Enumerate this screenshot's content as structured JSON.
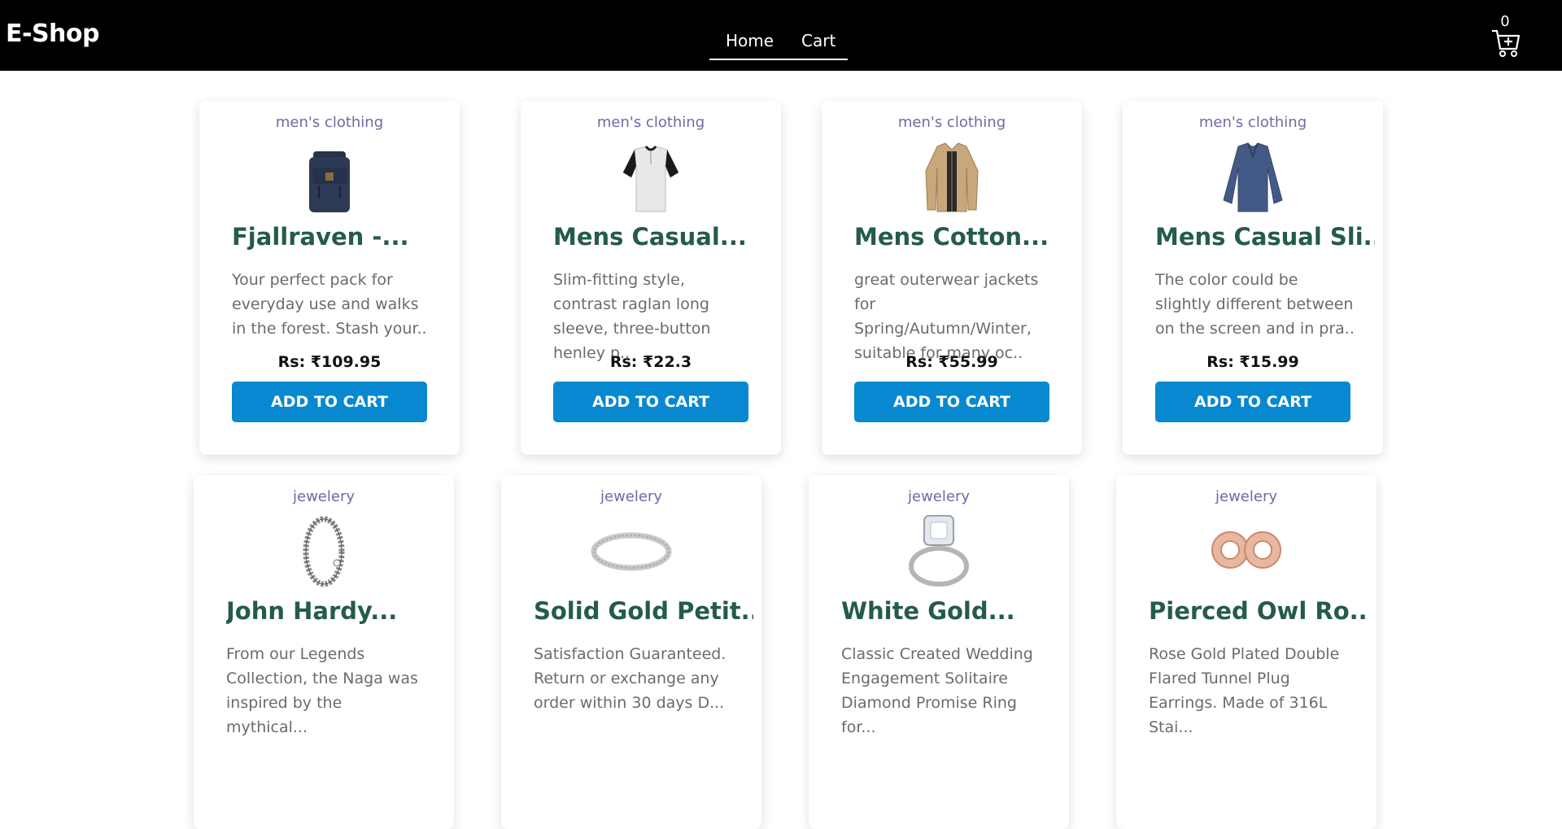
{
  "header": {
    "brand": "E-Shop",
    "nav": {
      "home": "Home",
      "cart": "Cart"
    },
    "cart_count": "0"
  },
  "products": [
    {
      "category": "men's clothing",
      "title": "Fjallraven -...",
      "description": "Your perfect pack for everyday use and walks in the forest. Stash your..",
      "price": "Rs: ₹109.95",
      "button": "ADD TO CART",
      "icon": "backpack-icon"
    },
    {
      "category": "men's clothing",
      "title": "Mens Casual...",
      "description": "Slim-fitting style, contrast raglan long sleeve, three-button henley p..",
      "price": "Rs: ₹22.3",
      "button": "ADD TO CART",
      "icon": "tshirt-icon"
    },
    {
      "category": "men's clothing",
      "title": "Mens Cotton...",
      "description": "great outerwear jackets for Spring/Autumn/Winter, suitable for many oc..",
      "price": "Rs: ₹55.99",
      "button": "ADD TO CART",
      "icon": "jacket-icon"
    },
    {
      "category": "men's clothing",
      "title": "Mens Casual Sli...",
      "description": "The color could be slightly different between on the screen and in pra..",
      "price": "Rs: ₹15.99",
      "button": "ADD TO CART",
      "icon": "long-sleeve-shirt-icon"
    },
    {
      "category": "jewelery",
      "title": "John Hardy...",
      "description": "From our Legends Collection, the Naga was inspired by the mythical...",
      "price": "",
      "button": "",
      "icon": "bracelet-icon"
    },
    {
      "category": "jewelery",
      "title": "Solid Gold Petit...",
      "description": "Satisfaction Guaranteed. Return or exchange any order within 30 days D...",
      "price": "",
      "button": "",
      "icon": "ring-icon"
    },
    {
      "category": "jewelery",
      "title": "White Gold...",
      "description": "Classic Created Wedding Engagement Solitaire Diamond Promise Ring for...",
      "price": "",
      "button": "",
      "icon": "diamond-ring-icon"
    },
    {
      "category": "jewelery",
      "title": "Pierced Owl Ro...",
      "description": "Rose Gold Plated Double Flared Tunnel Plug Earrings. Made of 316L Stai...",
      "price": "",
      "button": "",
      "icon": "earrings-icon"
    }
  ]
}
